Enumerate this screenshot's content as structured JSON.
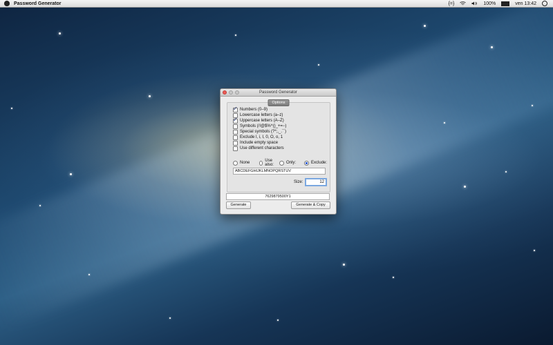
{
  "menubar": {
    "app_name": "Password Generator",
    "status_text": "{=}",
    "battery": "100%",
    "clock": "ven 13:42"
  },
  "window": {
    "title": "Password Generator",
    "options_label": "Options",
    "checkboxes": [
      {
        "label": "Numbers (0–9)",
        "checked": true
      },
      {
        "label": "Lowercase letters (a–z)",
        "checked": false
      },
      {
        "label": "Uppercase letters (A–Z)",
        "checked": true
      },
      {
        "label": "Symbols (/!@$%^()_+=−)",
        "checked": false
      },
      {
        "label": "Special symbols (?*;,_.`´)",
        "checked": false
      },
      {
        "label": "Exclude l, i, I, 0, O, o, 1",
        "checked": false
      },
      {
        "label": "Include empty space",
        "checked": false
      },
      {
        "label": "Use different characters",
        "checked": false
      }
    ],
    "radios": [
      {
        "label": "None",
        "selected": false
      },
      {
        "label": "Use also:",
        "selected": false
      },
      {
        "label": "Only:",
        "selected": false
      },
      {
        "label": "Exclude:",
        "selected": true
      }
    ],
    "chars_value": "ABCDEFGHIJKLMNOPQRSTUV",
    "size_label": "Size:",
    "size_value": "12",
    "password": "7629879500Y1",
    "generate_label": "Generate",
    "generate_copy_label": "Generate & Copy"
  }
}
